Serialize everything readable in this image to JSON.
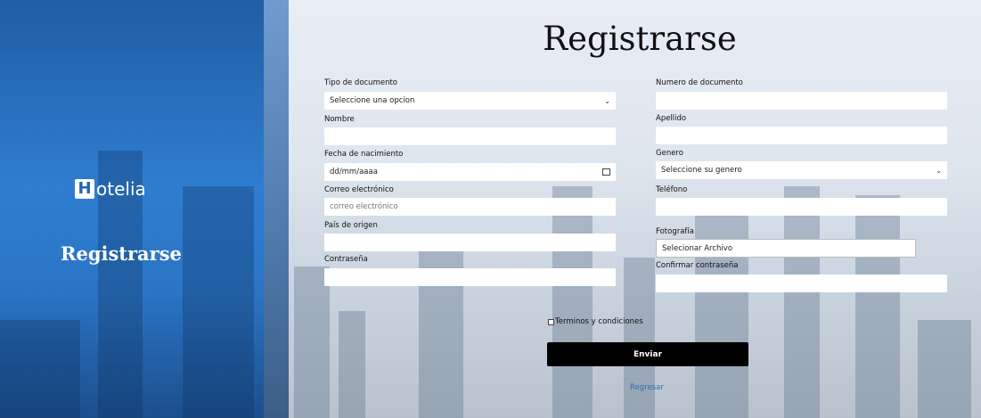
{
  "brand": {
    "logo_letter": "H",
    "logo_rest": "otelia"
  },
  "sidebar": {
    "title": "Registrarse"
  },
  "form": {
    "title": "Registrarse",
    "tipo_documento": {
      "label": "Tipo de documento",
      "value": "Seleccione una opcion"
    },
    "numero_documento": {
      "label": "Numero de documento",
      "value": ""
    },
    "nombre": {
      "label": "Nombre",
      "value": ""
    },
    "apellido": {
      "label": "Apellido",
      "value": ""
    },
    "fecha_nacimiento": {
      "label": "Fecha de nacimiento",
      "placeholder": "dd/mm/aaaa"
    },
    "genero": {
      "label": "Genero",
      "value": "Seleccione su genero"
    },
    "correo": {
      "label": "Correo electrónico",
      "placeholder": "correo electrónico"
    },
    "telefono": {
      "label": "Teléfono",
      "value": ""
    },
    "pais": {
      "label": "País de origen",
      "value": ""
    },
    "fotografia": {
      "label": "Fotografía",
      "button": "Selecionar Archivo"
    },
    "contrasena": {
      "label": "Contraseña",
      "value": ""
    },
    "confirmar": {
      "label": "Confirmar contraseña",
      "value": ""
    },
    "terminos": "Terminos y condiciones",
    "submit": "Enviar",
    "back": "Regresar"
  },
  "colors": {
    "panel": "#2f7dd0",
    "button": "#000000",
    "link": "#2d6db5"
  }
}
